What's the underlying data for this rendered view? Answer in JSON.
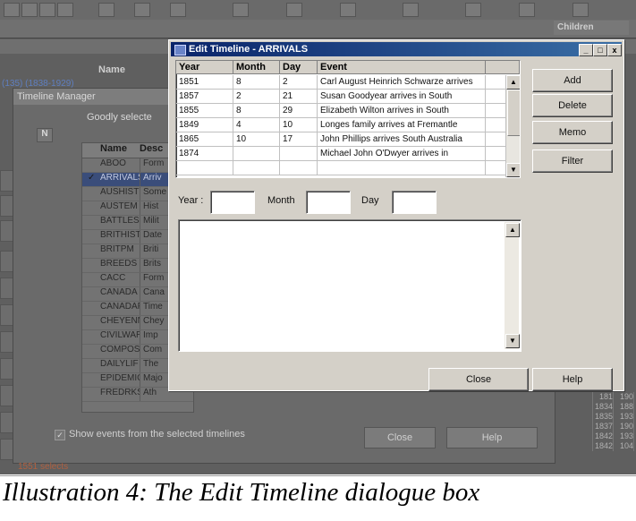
{
  "background": {
    "children_label": "Children",
    "name_header": "Name",
    "id_line": "(135) (1838-1929)",
    "timeline_manager": {
      "title": "Timeline Manager",
      "subtitle": "Goodly selecte",
      "col_n": "N",
      "columns": [
        "Name",
        "Desc"
      ],
      "rows": [
        {
          "name": "ABOO",
          "desc": "Form",
          "checked": false,
          "selected": false
        },
        {
          "name": "ARRIVALS",
          "desc": "Arriv",
          "checked": true,
          "selected": true
        },
        {
          "name": "AUSHIST",
          "desc": "Some",
          "checked": false,
          "selected": false
        },
        {
          "name": "AUSTEM",
          "desc": "Hist",
          "checked": false,
          "selected": false
        },
        {
          "name": "BATTLES",
          "desc": "Milit",
          "checked": false,
          "selected": false
        },
        {
          "name": "BRITHIST",
          "desc": "Date",
          "checked": false,
          "selected": false
        },
        {
          "name": "BRITPM",
          "desc": "Briti",
          "checked": false,
          "selected": false
        },
        {
          "name": "BREEDS",
          "desc": "Brits",
          "checked": false,
          "selected": false
        },
        {
          "name": "CACC",
          "desc": "Form",
          "checked": false,
          "selected": false
        },
        {
          "name": "CANADA",
          "desc": "Cana",
          "checked": false,
          "selected": false
        },
        {
          "name": "CANADAPM",
          "desc": "Time",
          "checked": false,
          "selected": false
        },
        {
          "name": "CHEYENNE",
          "desc": "Chey",
          "checked": false,
          "selected": false
        },
        {
          "name": "CIVILWAR",
          "desc": "Imp",
          "checked": false,
          "selected": false
        },
        {
          "name": "COMPOSER",
          "desc": "Com",
          "checked": false,
          "selected": false
        },
        {
          "name": "DAILYLIF",
          "desc": "The",
          "checked": false,
          "selected": false
        },
        {
          "name": "EPIDEMIC",
          "desc": "Majo",
          "checked": false,
          "selected": false
        },
        {
          "name": "FREDRKSB",
          "desc": "Ath",
          "checked": false,
          "selected": false
        }
      ],
      "show_events_label": "Show events from the selected timelines",
      "close_label": "Close",
      "help_label": "Help"
    },
    "right_grid": [
      [
        "",
        "181",
        "190"
      ],
      [
        "",
        "1834",
        "188"
      ],
      [
        "",
        "1835",
        "193"
      ],
      [
        "",
        "1837",
        "190"
      ],
      [
        "",
        "1842",
        "193"
      ],
      [
        "",
        "1842",
        "104"
      ]
    ],
    "footer_left": "1551 selects"
  },
  "dialog": {
    "title": "Edit Timeline - ARRIVALS",
    "window_buttons": [
      "_",
      "□",
      "x"
    ],
    "grid": {
      "columns": [
        "Year",
        "Month",
        "Day",
        "Event"
      ],
      "rows": [
        {
          "year": "1851",
          "month": "8",
          "day": "2",
          "event": "Carl August Heinrich Schwarze arrives"
        },
        {
          "year": "1857",
          "month": "2",
          "day": "21",
          "event": "Susan Goodyear arrives in South"
        },
        {
          "year": "1855",
          "month": "8",
          "day": "29",
          "event": "Elizabeth Wilton arrives in South"
        },
        {
          "year": "1849",
          "month": "4",
          "day": "10",
          "event": "Longes family arrives at Fremantle"
        },
        {
          "year": "1865",
          "month": "10",
          "day": "17",
          "event": "John Phillips arrives South Australia"
        },
        {
          "year": "1874",
          "month": "",
          "day": "",
          "event": "Michael John O'Dwyer arrives in"
        },
        {
          "year": "",
          "month": "",
          "day": "",
          "event": ""
        }
      ]
    },
    "buttons": {
      "add": "Add",
      "delete": "Delete",
      "memo": "Memo",
      "filter": "Filter",
      "close": "Close",
      "help": "Help"
    },
    "fields": {
      "year_label": "Year :",
      "month_label": "Month",
      "day_label": "Day",
      "year_value": "",
      "month_value": "",
      "day_value": ""
    }
  },
  "caption": "Illustration 4: The Edit Timeline dialogue box"
}
